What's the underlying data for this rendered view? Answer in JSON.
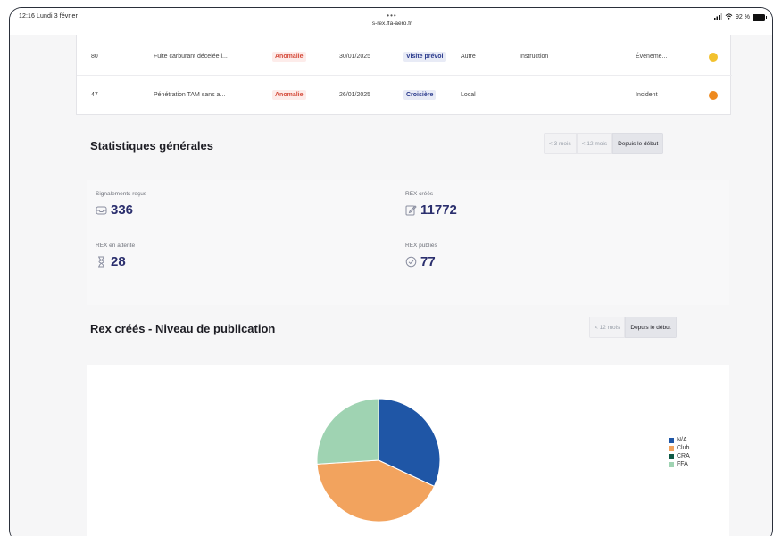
{
  "status_bar": {
    "time_date": "12:16  Lundi 3 février",
    "url": "s-rex.ffa-aero.fr",
    "battery": "92 %"
  },
  "table": {
    "rows": [
      {
        "id": "80",
        "title": "Fuite carburant décelée l...",
        "type": "Anomalie",
        "date": "30/01/2025",
        "tag": "Visite prévol",
        "scope": "Autre",
        "status": "Instruction",
        "category": "Événeme...",
        "dot_color": "#f2c12e"
      },
      {
        "id": "47",
        "title": "Pénétration TAM sans a...",
        "type": "Anomalie",
        "date": "26/01/2025",
        "tag": "Croisière",
        "scope": "Local",
        "status": "",
        "category": "Incident",
        "dot_color": "#ee8a1f"
      }
    ]
  },
  "stats_section": {
    "title": "Statistiques générales",
    "filters": [
      "< 3 mois",
      "< 12 mois",
      "Depuis le début"
    ],
    "active_filter": "Depuis le début",
    "items": [
      {
        "label": "Signalements reçus",
        "value": "336",
        "icon": "inbox-icon"
      },
      {
        "label": "REX créés",
        "value": "11772",
        "icon": "edit-icon"
      },
      {
        "label": "REX en attente",
        "value": "28",
        "icon": "hourglass-icon"
      },
      {
        "label": "REX publiés",
        "value": "77",
        "icon": "check-circle-icon"
      }
    ]
  },
  "chart_section": {
    "title": "Rex créés - Niveau de publication",
    "filters": [
      "< 12 mois",
      "Depuis le début"
    ],
    "active_filter": "Depuis le début"
  },
  "chart_data": {
    "type": "pie",
    "title": "",
    "legend_position": "right",
    "slices": [
      {
        "label": "N/A",
        "value": 32,
        "color": "#1f56a6"
      },
      {
        "label": "Club",
        "value": 42,
        "color": "#f2a35e"
      },
      {
        "label": "CRA",
        "value": 0,
        "color": "#0f5a45"
      },
      {
        "label": "FFA",
        "value": 26,
        "color": "#9fd3b2"
      }
    ]
  }
}
